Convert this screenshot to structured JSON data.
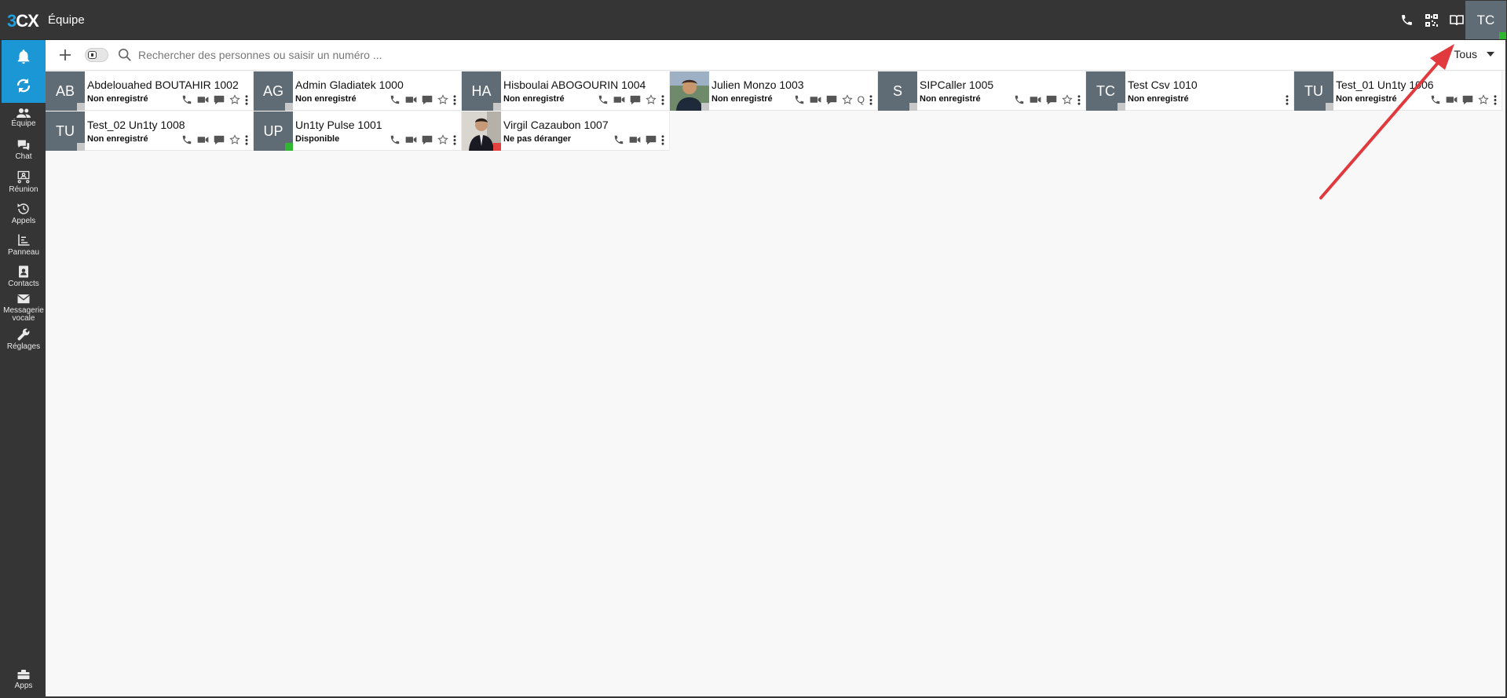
{
  "app": {
    "logo_prefix": "3",
    "logo_suffix": "CX",
    "title": "Équipe",
    "user_initials": "TC"
  },
  "colors": {
    "accent": "#1b97d5",
    "dark": "#353535",
    "avatar_bg": "#5f6b75",
    "status_offline": "#c8c8c8",
    "status_available": "#2fb82f",
    "status_dnd": "#e5413f",
    "annotation_arrow": "#e0393e"
  },
  "top_icons": [
    "phone-icon",
    "qr-code-icon",
    "book-icon"
  ],
  "sidebar": {
    "items": [
      {
        "label": "Équipe",
        "icon": "people-icon"
      },
      {
        "label": "Chat",
        "icon": "chat-icon"
      },
      {
        "label": "Réunion",
        "icon": "meeting-icon"
      },
      {
        "label": "Appels",
        "icon": "history-icon"
      },
      {
        "label": "Panneau",
        "icon": "panel-icon"
      },
      {
        "label": "Contacts",
        "icon": "contacts-icon"
      },
      {
        "label": "Messagerie vocale",
        "icon": "mail-icon"
      },
      {
        "label": "Réglages",
        "icon": "wrench-icon"
      }
    ],
    "apps_label": "Apps"
  },
  "toolbar": {
    "search_placeholder": "Rechercher des personnes ou saisir un numéro ...",
    "filter_label": "Tous"
  },
  "contacts": [
    {
      "initials": "AB",
      "name": "Abdelouahed BOUTAHIR 1002",
      "state": "Non enregistré",
      "status": "offline",
      "photo": false,
      "queue": false
    },
    {
      "initials": "AG",
      "name": "Admin Gladiatek 1000",
      "state": "Non enregistré",
      "status": "offline",
      "photo": false,
      "queue": false
    },
    {
      "initials": "HA",
      "name": "Hisboulai ABOGOURIN 1004",
      "state": "Non enregistré",
      "status": "offline",
      "photo": false,
      "queue": false
    },
    {
      "initials": "",
      "name": "Julien Monzo 1003",
      "state": "Non enregistré",
      "status": "offline",
      "photo": true,
      "queue": true,
      "queue_label": "Q"
    },
    {
      "initials": "S",
      "name": "SIPCaller 1005",
      "state": "Non enregistré",
      "status": "offline",
      "photo": false,
      "queue": false
    },
    {
      "initials": "TC",
      "name": "Test Csv 1010",
      "state": "Non enregistré",
      "status": "offline",
      "photo": false,
      "queue": false,
      "more_only": true
    },
    {
      "initials": "TU",
      "name": "Test_01 Un1ty 1006",
      "state": "Non enregistré",
      "status": "offline",
      "photo": false,
      "queue": false
    },
    {
      "initials": "TU",
      "name": "Test_02 Un1ty 1008",
      "state": "Non enregistré",
      "status": "offline",
      "photo": false,
      "queue": false
    },
    {
      "initials": "UP",
      "name": "Un1ty Pulse 1001",
      "state": "Disponible",
      "status": "available",
      "photo": false,
      "queue": false
    },
    {
      "initials": "",
      "name": "Virgil Cazaubon 1007",
      "state": "Ne pas déranger",
      "status": "dnd",
      "photo": true,
      "queue": false,
      "no_star": true
    }
  ]
}
